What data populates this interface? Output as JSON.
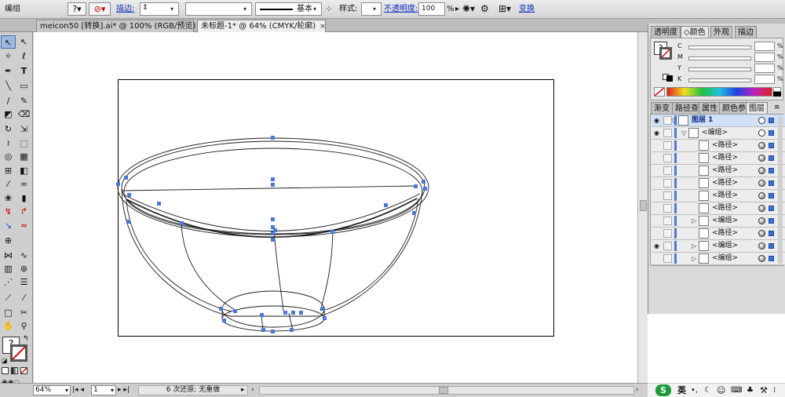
{
  "control_bar": {
    "selection_label": "编组",
    "fill_icon": "question-swatch-icon",
    "stroke_icon": "none-stroke-icon",
    "stroke_label": "描边:",
    "stroke_style_label": "基本",
    "style_label": "样式:",
    "opacity_label": "不透明度:",
    "opacity_value": "100",
    "percent": "%",
    "transform_label": "变换"
  },
  "tabs": [
    {
      "label": "meicon50 [转换].ai* @ 100% (RGB/预览)",
      "close": "×"
    },
    {
      "label": "未标题-1* @ 64% (CMYK/轮廓)",
      "close": "×"
    }
  ],
  "status_bar": {
    "zoom": "64%",
    "page": "1",
    "undo_text": "6 次还原; 无重做"
  },
  "color_panel": {
    "tabs": [
      "透明度",
      "颜色",
      "外观",
      "描边"
    ],
    "active_tab": "颜色",
    "channels": [
      {
        "label": "C",
        "unit": "%"
      },
      {
        "label": "M",
        "unit": "%"
      },
      {
        "label": "Y",
        "unit": "%"
      },
      {
        "label": "K",
        "unit": "%"
      }
    ]
  },
  "layers_panel": {
    "tabs": [
      "渐变",
      "路径查",
      "属性",
      "颜色参",
      "图层"
    ],
    "active_tab": "图层",
    "rows": [
      {
        "name": "图层 1",
        "indent": 0,
        "expander": "▽",
        "selected": true,
        "eye": true
      },
      {
        "name": "<编组>",
        "indent": 1,
        "expander": "▽",
        "selected": false,
        "eye": true
      },
      {
        "name": "<路径>",
        "indent": 2,
        "expander": "",
        "selected": false,
        "eye": false
      },
      {
        "name": "<路径>",
        "indent": 2,
        "expander": "",
        "selected": false,
        "eye": false
      },
      {
        "name": "<路径>",
        "indent": 2,
        "expander": "",
        "selected": false,
        "eye": false
      },
      {
        "name": "<路径>",
        "indent": 2,
        "expander": "",
        "selected": false,
        "eye": false
      },
      {
        "name": "<路径>",
        "indent": 2,
        "expander": "",
        "selected": false,
        "eye": false
      },
      {
        "name": "<路径>",
        "indent": 2,
        "expander": "",
        "selected": false,
        "eye": false
      },
      {
        "name": "<编组>",
        "indent": 2,
        "expander": "▷",
        "selected": false,
        "eye": false
      },
      {
        "name": "<路径>",
        "indent": 2,
        "expander": "",
        "selected": false,
        "eye": false
      },
      {
        "name": "<编组>",
        "indent": 2,
        "expander": "▷",
        "selected": false,
        "eye": true
      },
      {
        "name": "<编组>",
        "indent": 2,
        "expander": "▷",
        "selected": false,
        "eye": false
      }
    ]
  },
  "taskbar": {
    "ime_label": "英"
  },
  "colors": {
    "anchor": "#4a78d8",
    "selection_blue": "#3a6fd8",
    "layer_highlight": "#cfe0f7"
  }
}
